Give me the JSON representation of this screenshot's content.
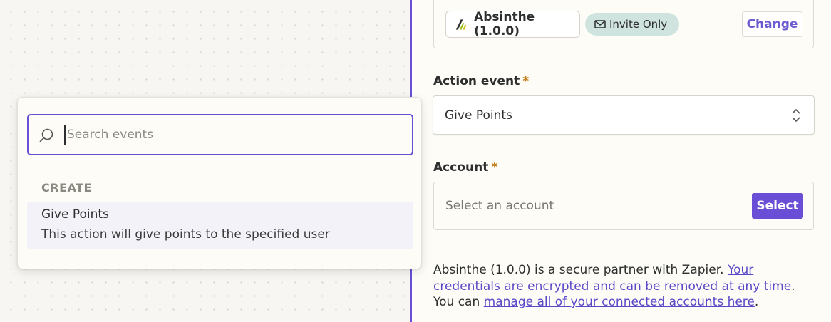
{
  "app": {
    "name": "Absinthe (1.0.0)",
    "logo_icon": "absinthe-logo-icon",
    "invite_label": "Invite Only",
    "invite_icon": "mail-icon",
    "change_label": "Change"
  },
  "action_event": {
    "label": "Action event",
    "required_mark": "*",
    "value": "Give Points"
  },
  "account": {
    "label": "Account",
    "required_mark": "*",
    "placeholder": "Select an account",
    "select_label": "Select"
  },
  "info": {
    "text_1": "Absinthe (1.0.0) is a secure partner with Zapier. ",
    "link_1": "Your credentials are encrypted and can be removed at any time",
    "text_2": ". You can ",
    "link_2": "manage all of your connected accounts here",
    "text_3": "."
  },
  "dropdown": {
    "search_placeholder": "Search events",
    "section_title": "CREATE",
    "options": [
      {
        "title": "Give Points",
        "description": "This action will give points to the specified user"
      }
    ]
  },
  "colors": {
    "accent": "#6a4fd6",
    "link": "#5a48c8",
    "badge_bg": "#cfe4df",
    "required": "#c27a16"
  }
}
